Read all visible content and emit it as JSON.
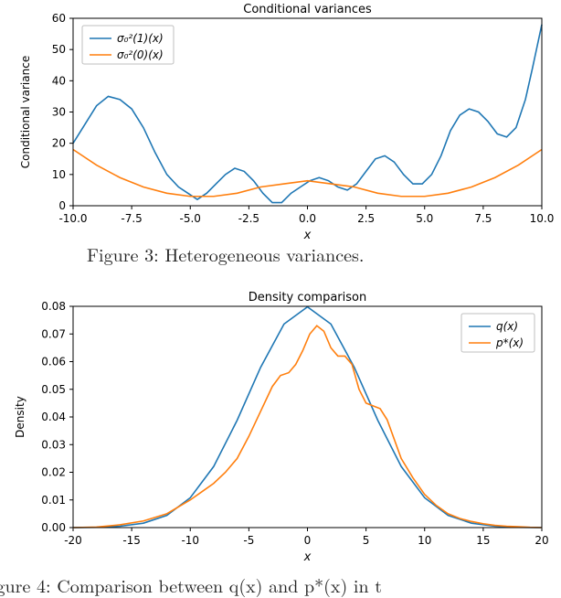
{
  "figure3": {
    "title": "Conditional variances",
    "xlabel": "x",
    "ylabel": "Conditional variance",
    "caption": "Figure 3: Heterogeneous variances.",
    "legend": {
      "s1": "σ₀²(1)(x)",
      "s2": "σ₀²(0)(x)"
    }
  },
  "figure4": {
    "title": "Density comparison",
    "xlabel": "x",
    "ylabel": "Density",
    "caption_partial": "igure 4: Comparison between q(x) and p*(x) in t",
    "legend": {
      "q": "q(x)",
      "p": "p*(x)"
    }
  },
  "chart_data": [
    {
      "type": "line",
      "title": "Conditional variances",
      "xlabel": "x",
      "ylabel": "Conditional variance",
      "xlim": [
        -10,
        10
      ],
      "ylim": [
        0,
        60
      ],
      "xticks": [
        -10,
        -7.5,
        -5,
        -2.5,
        0,
        2.5,
        5,
        7.5,
        10
      ],
      "yticks": [
        0,
        10,
        20,
        30,
        40,
        50,
        60
      ],
      "legend_position": "upper-left",
      "series": [
        {
          "name": "σ₀²(1)(x)",
          "color": "#1f77b4",
          "x": [
            -10.0,
            -9.5,
            -9.0,
            -8.5,
            -8.0,
            -7.5,
            -7.0,
            -6.5,
            -6.0,
            -5.5,
            -5.1,
            -4.7,
            -4.3,
            -3.9,
            -3.5,
            -3.1,
            -2.7,
            -2.3,
            -1.9,
            -1.5,
            -1.1,
            -0.7,
            -0.3,
            0.1,
            0.5,
            0.9,
            1.3,
            1.7,
            2.1,
            2.5,
            2.9,
            3.3,
            3.7,
            4.1,
            4.5,
            4.9,
            5.3,
            5.7,
            6.1,
            6.5,
            6.9,
            7.3,
            7.7,
            8.1,
            8.5,
            8.9,
            9.3,
            9.6,
            9.8,
            10.0
          ],
          "values": [
            20,
            26,
            32,
            35,
            34,
            31,
            25,
            17,
            10,
            6,
            4,
            2,
            4,
            7,
            10,
            12,
            11,
            8,
            4,
            1,
            1,
            4,
            6,
            8,
            9,
            8,
            6,
            5,
            7,
            11,
            15,
            16,
            14,
            10,
            7,
            7,
            10,
            16,
            24,
            29,
            31,
            30,
            27,
            23,
            22,
            25,
            34,
            44,
            51,
            58
          ]
        },
        {
          "name": "σ₀²(0)(x)",
          "color": "#ff7f0e",
          "x": [
            -10.0,
            -9.0,
            -8.0,
            -7.0,
            -6.0,
            -5.0,
            -4.0,
            -3.0,
            -2.0,
            -1.0,
            0.0,
            1.0,
            2.0,
            3.0,
            4.0,
            5.0,
            6.0,
            7.0,
            8.0,
            9.0,
            10.0
          ],
          "values": [
            18,
            13,
            9,
            6,
            4,
            3,
            3,
            4,
            6,
            7,
            8,
            7,
            6,
            4,
            3,
            3,
            4,
            6,
            9,
            13,
            18
          ]
        }
      ]
    },
    {
      "type": "line",
      "title": "Density comparison",
      "xlabel": "x",
      "ylabel": "Density",
      "xlim": [
        -20,
        20
      ],
      "ylim": [
        0,
        0.08
      ],
      "xticks": [
        -20,
        -15,
        -10,
        -5,
        0,
        5,
        10,
        15,
        20
      ],
      "yticks": [
        0.0,
        0.01,
        0.02,
        0.03,
        0.04,
        0.05,
        0.06,
        0.07,
        0.08
      ],
      "legend_position": "upper-right",
      "series": [
        {
          "name": "q(x)",
          "color": "#1f77b4",
          "x": [
            -20,
            -18,
            -16,
            -14,
            -12,
            -10,
            -8,
            -6,
            -4,
            -2,
            0,
            2,
            4,
            6,
            8,
            10,
            12,
            14,
            16,
            18,
            20
          ],
          "values": [
            0.0,
            0.0001,
            0.0005,
            0.0016,
            0.0044,
            0.0108,
            0.0221,
            0.0388,
            0.0579,
            0.0736,
            0.0798,
            0.0736,
            0.0579,
            0.0388,
            0.0221,
            0.0108,
            0.0044,
            0.0016,
            0.0005,
            0.0001,
            0.0
          ]
        },
        {
          "name": "p*(x)",
          "color": "#ff7f0e",
          "x": [
            -20,
            -18,
            -16,
            -14,
            -12,
            -10,
            -9,
            -8,
            -7,
            -6,
            -5,
            -4,
            -3,
            -2.3,
            -1.6,
            -1.0,
            -0.4,
            0.2,
            0.8,
            1.4,
            2.0,
            2.6,
            3.2,
            3.8,
            4.4,
            5.0,
            5.6,
            6.2,
            6.8,
            7.4,
            8.0,
            9.0,
            10.0,
            11.0,
            12.0,
            13.0,
            14.0,
            15.0,
            16.0,
            17.0,
            18.0,
            19.0,
            20.0
          ],
          "values": [
            0.0,
            0.0002,
            0.001,
            0.0024,
            0.005,
            0.01,
            0.013,
            0.016,
            0.02,
            0.025,
            0.033,
            0.042,
            0.051,
            0.055,
            0.056,
            0.059,
            0.064,
            0.07,
            0.073,
            0.071,
            0.065,
            0.062,
            0.062,
            0.059,
            0.05,
            0.045,
            0.044,
            0.043,
            0.039,
            0.032,
            0.025,
            0.018,
            0.012,
            0.008,
            0.005,
            0.0033,
            0.0022,
            0.0014,
            0.0008,
            0.0005,
            0.0003,
            0.0001,
            0.0
          ]
        }
      ]
    }
  ]
}
